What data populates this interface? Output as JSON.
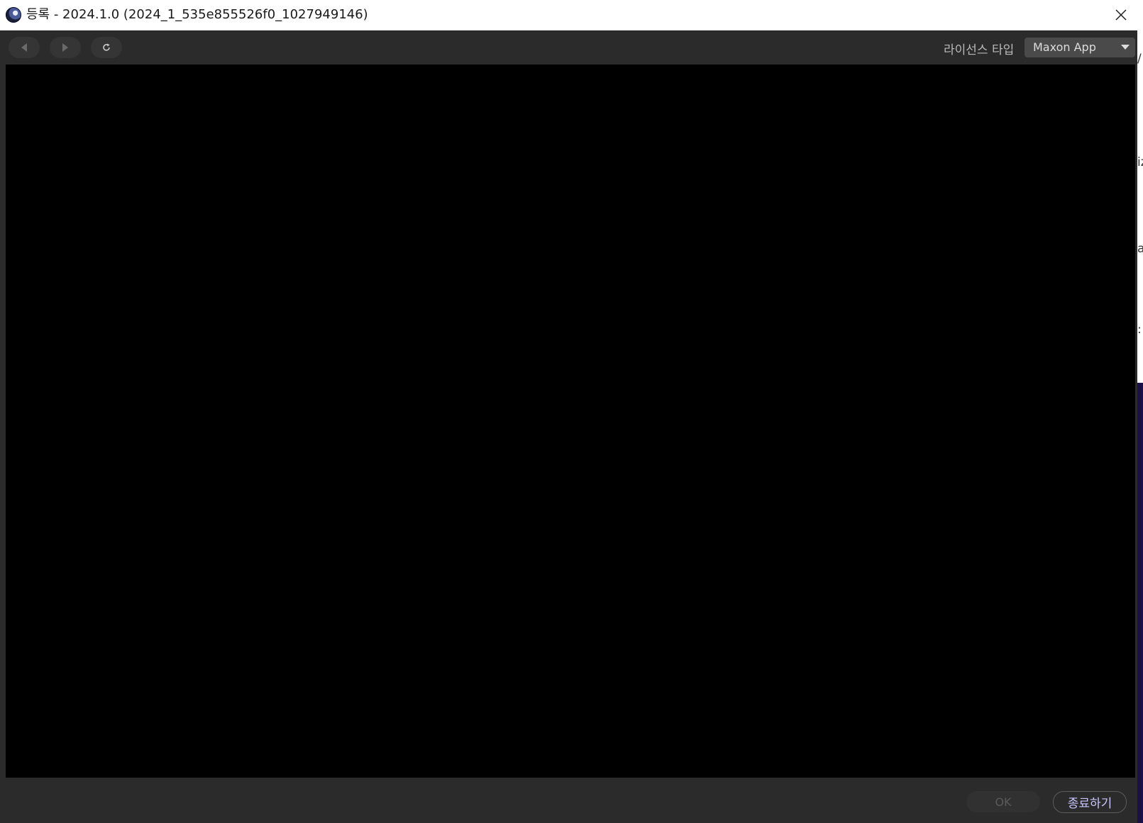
{
  "window": {
    "title": "등록 - 2024.1.0 (2024_1_535e855526f0_1027949146)",
    "app_icon": "cinema4d-icon",
    "close_icon": "close-icon"
  },
  "toolbar": {
    "back_icon": "back-arrow-icon",
    "forward_icon": "forward-arrow-icon",
    "refresh_icon": "refresh-icon",
    "license_label": "라이선스 타입",
    "license_value": "Maxon App"
  },
  "footer": {
    "ok_label": "OK",
    "quit_label": "종료하기"
  },
  "background_window": {
    "glyphs": [
      "/",
      "iz",
      "a",
      ":"
    ]
  },
  "colors": {
    "window_bg": "#2b2b2b",
    "content_bg": "#000000",
    "quit_text": "#c9c6ff",
    "background_accent": "#1b0f4a"
  }
}
